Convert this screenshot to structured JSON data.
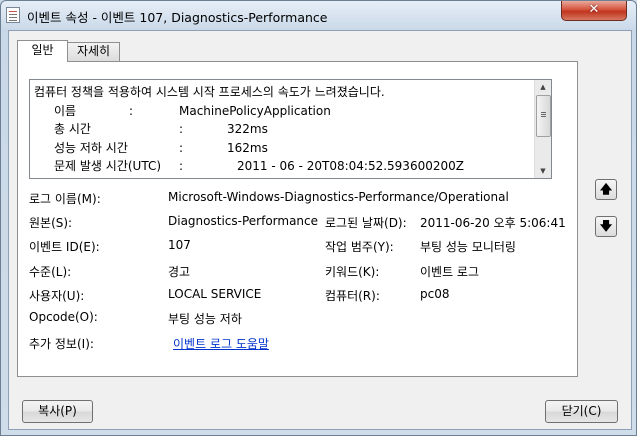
{
  "window": {
    "title": "이벤트 속성 - 이벤트 107, Diagnostics-Performance",
    "close_glyph": "✕"
  },
  "tabs": [
    {
      "label": "일반",
      "active": true
    },
    {
      "label": "자세히",
      "active": false
    }
  ],
  "description": {
    "intro": "컴퓨터 정책을 적용하여 시스템 시작 프로세스의 속도가 느려졌습니다.",
    "lines": [
      {
        "label": "이름",
        "sep": ":",
        "value": "MachinePolicyApplication"
      },
      {
        "label": "총 시간",
        "sep": ":",
        "value": "322ms"
      },
      {
        "label": "성능 저하 시간",
        "sep": ":",
        "value": "162ms"
      },
      {
        "label": "문제 발생 시간(UTC)",
        "sep": ":",
        "value": "2011  -  06  -  20T08:04:52.593600200Z"
      }
    ]
  },
  "properties": {
    "log_name_label": "로그 이름(M):",
    "log_name": "Microsoft-Windows-Diagnostics-Performance/Operational",
    "source_label": "원본(S):",
    "source": "Diagnostics-Performance",
    "logged_label": "로그된 날짜(D):",
    "logged": "2011-06-20 오후 5:06:41",
    "event_id_label": "이벤트 ID(E):",
    "event_id": "107",
    "task_category_label": "작업 범주(Y):",
    "task_category": "부팅 성능 모니터링",
    "level_label": "수준(L):",
    "level": "경고",
    "keywords_label": "키워드(K):",
    "keywords": "이벤트 로그",
    "user_label": "사용자(U):",
    "user": "LOCAL SERVICE",
    "computer_label": "컴퓨터(R):",
    "computer": "pc08",
    "opcode_label": "Opcode(O):",
    "opcode": "부팅 성능 저하",
    "more_info_label": "추가 정보(I):",
    "more_info_link": "이벤트 로그 도움말"
  },
  "side_buttons": {
    "up_icon": "🡅",
    "down_icon": "🡇"
  },
  "buttons": {
    "copy": "복사(P)",
    "close": "닫기(C)"
  }
}
